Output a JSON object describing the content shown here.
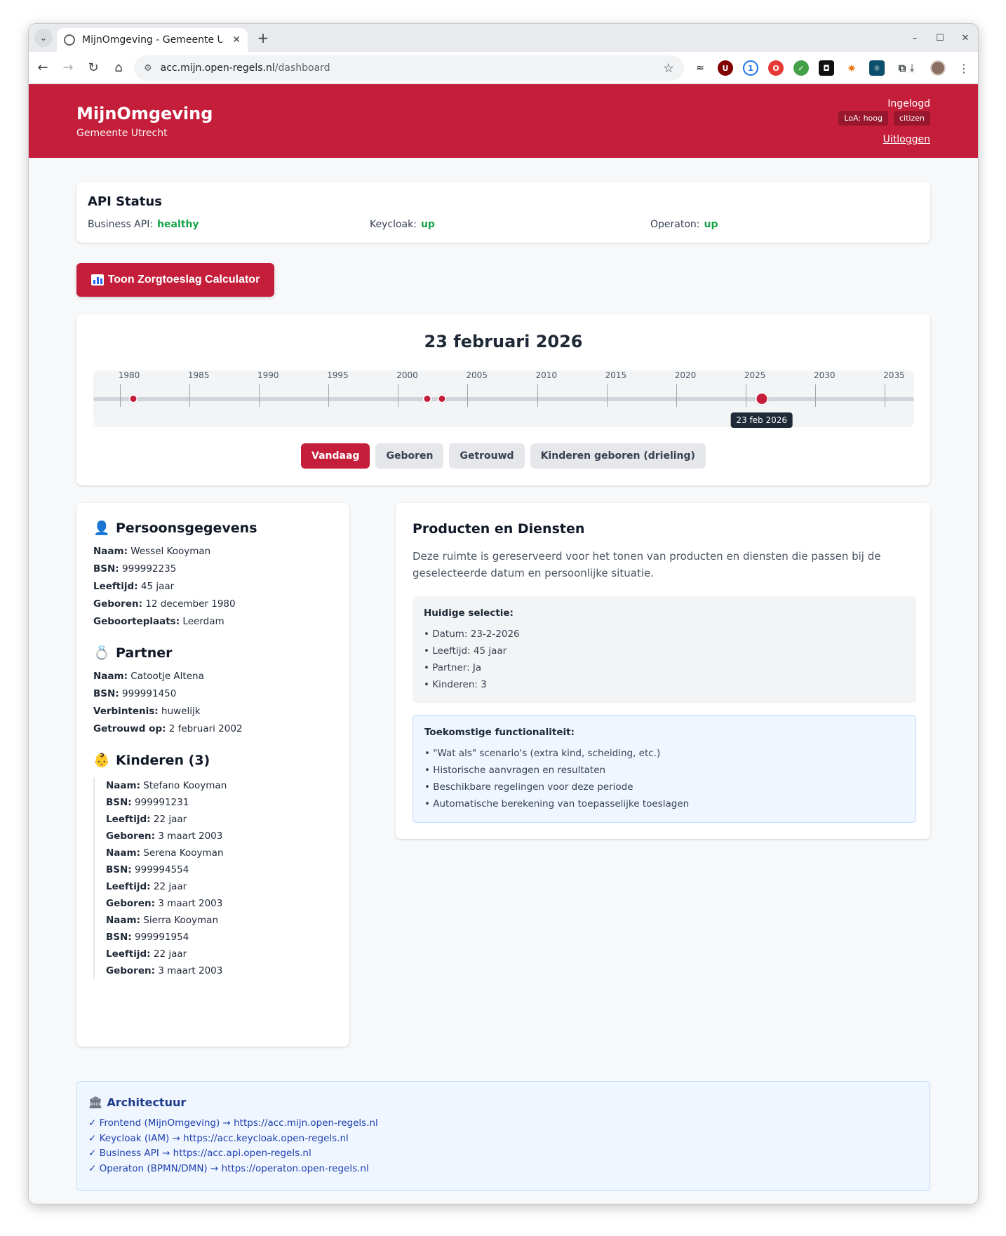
{
  "browser": {
    "tab_title": "MijnOmgeving - Gemeente Utrecht",
    "url_host": "acc.mijn.open-regels.nl",
    "url_path": "/dashboard"
  },
  "header": {
    "brand": "MijnOmgeving",
    "municipality": "Gemeente Utrecht",
    "login_status": "Ingelogd",
    "loa_badge": "LoA: hoog",
    "role_badge": "citizen",
    "logout": "Uitloggen"
  },
  "api_status": {
    "title": "API Status",
    "items": [
      {
        "label": "Business API:",
        "value": "healthy"
      },
      {
        "label": "Keycloak:",
        "value": "up"
      },
      {
        "label": "Operaton:",
        "value": "up"
      }
    ]
  },
  "calculator_button": "Toon Zorgtoeslag Calculator",
  "timeline": {
    "selected_date": "23 februari 2026",
    "years": [
      "1980",
      "1985",
      "1990",
      "1995",
      "2000",
      "2005",
      "2010",
      "2015",
      "2020",
      "2025",
      "2030",
      "2035"
    ],
    "start_year": 1978.5,
    "end_year": 2036,
    "events": [
      1980.95,
      2002.09,
      2003.17
    ],
    "current": 2026.15,
    "tooltip": "23 feb 2026",
    "buttons": [
      "Vandaag",
      "Geboren",
      "Getrouwd",
      "Kinderen geboren (drieling)"
    ]
  },
  "person": {
    "title": "Persoonsgegevens",
    "fields": [
      {
        "label": "Naam:",
        "value": "Wessel Kooyman"
      },
      {
        "label": "BSN:",
        "value": "999992235"
      },
      {
        "label": "Leeftijd:",
        "value": "45 jaar"
      },
      {
        "label": "Geboren:",
        "value": "12 december 1980"
      },
      {
        "label": "Geboorteplaats:",
        "value": "Leerdam"
      }
    ]
  },
  "partner": {
    "title": "Partner",
    "fields": [
      {
        "label": "Naam:",
        "value": "Catootje Altena"
      },
      {
        "label": "BSN:",
        "value": "999991450"
      },
      {
        "label": "Verbintenis:",
        "value": "huwelijk"
      },
      {
        "label": "Getrouwd op:",
        "value": "2 februari 2002"
      }
    ]
  },
  "children": {
    "title": "Kinderen (3)",
    "labels": {
      "name": "Naam:",
      "bsn": "BSN:",
      "age": "Leeftijd:",
      "born": "Geboren:"
    },
    "items": [
      {
        "name": "Stefano Kooyman",
        "bsn": "999991231",
        "age": "22 jaar",
        "born": "3 maart 2003"
      },
      {
        "name": "Serena Kooyman",
        "bsn": "999994554",
        "age": "22 jaar",
        "born": "3 maart 2003"
      },
      {
        "name": "Sierra Kooyman",
        "bsn": "999991954",
        "age": "22 jaar",
        "born": "3 maart 2003"
      }
    ]
  },
  "products": {
    "title": "Producten en Diensten",
    "description": "Deze ruimte is gereserveerd voor het tonen van producten en diensten die passen bij de geselecteerde datum en persoonlijke situatie.",
    "selection_title": "Huidige selectie:",
    "selection": [
      "• Datum: 23-2-2026",
      "• Leeftijd: 45 jaar",
      "• Partner: Ja",
      "• Kinderen: 3"
    ],
    "future_title": "Toekomstige functionaliteit:",
    "future": [
      "• \"Wat als\" scenario's (extra kind, scheiding, etc.)",
      "• Historische aanvragen en resultaten",
      "• Beschikbare regelingen voor deze periode",
      "• Automatische berekening van toepasselijke toeslagen"
    ]
  },
  "architecture": {
    "title": "Architectuur",
    "items": [
      "✓ Frontend (MijnOmgeving) → https://acc.mijn.open-regels.nl",
      "✓ Keycloak (IAM) → https://acc.keycloak.open-regels.nl",
      "✓ Business API → https://acc.api.open-regels.nl",
      "✓ Operaton (BPMN/DMN) → https://operaton.open-regels.nl"
    ]
  },
  "colors": {
    "brand_red": "#c41e3a",
    "status_green": "#16a34a",
    "info_blue": "#1e40af"
  }
}
